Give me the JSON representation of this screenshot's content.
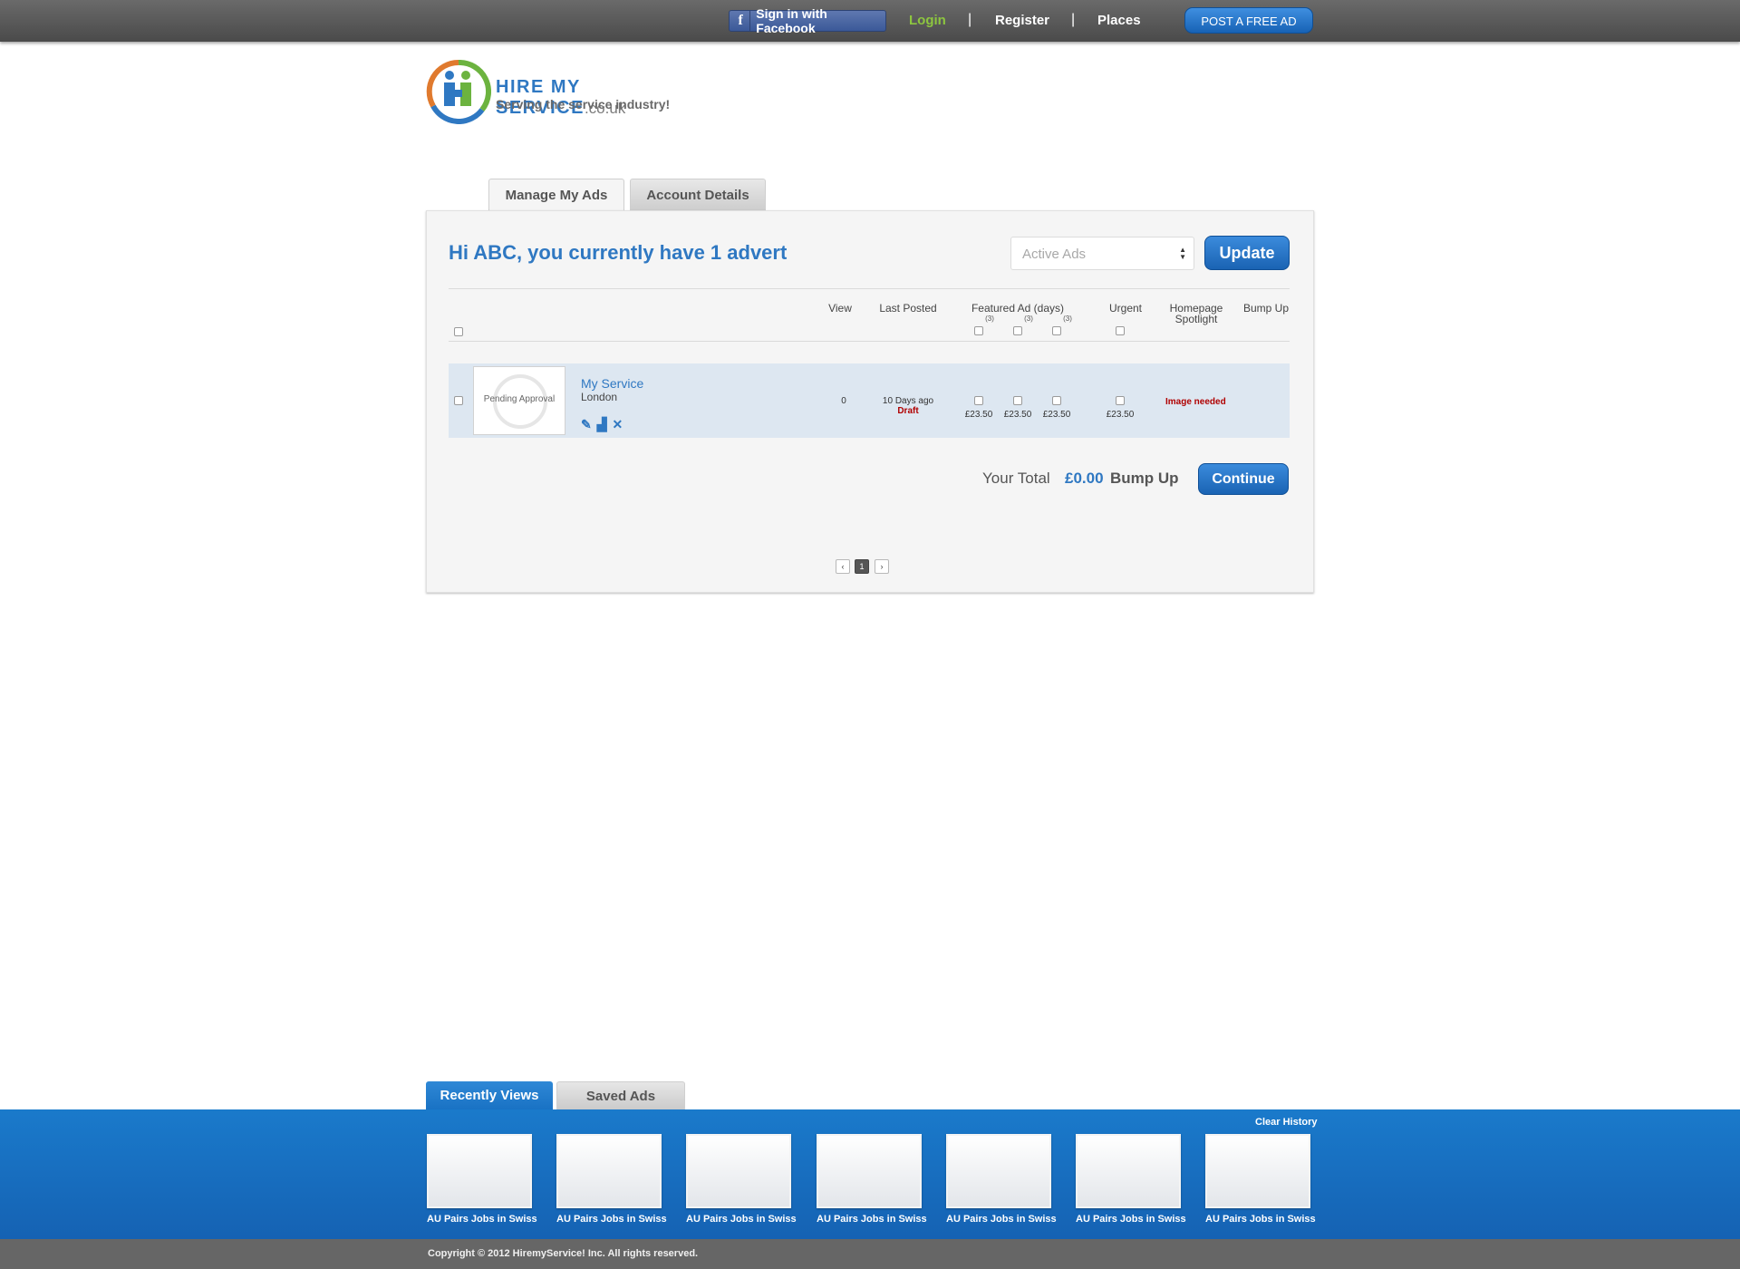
{
  "header": {
    "facebook_label": "Sign in with Facebook",
    "login": "Login",
    "register": "Register",
    "places": "Places",
    "separator": "|",
    "post_ad": "POST A FREE AD"
  },
  "logo": {
    "title": "HIRE MY SERVICE",
    "tld": ".co.uk",
    "tagline": "Serving the service industry!"
  },
  "tabs": [
    "Manage My Ads",
    "Account Details"
  ],
  "panel": {
    "greeting": "Hi ABC, you currently have 1 advert",
    "filter_value": "Active Ads",
    "update": "Update",
    "columns": {
      "view": "View",
      "last_posted": "Last Posted",
      "featured": "Featured Ad (days)",
      "featured_days": [
        "(3)",
        "(3)",
        "(3)"
      ],
      "urgent": "Urgent",
      "homepage": "Homepage Spotlight",
      "bump": "Bump Up"
    },
    "ad": {
      "thumb_text": "Pending Approval",
      "title": "My Service",
      "location": "London",
      "views": "0",
      "last_posted": "10 Days ago",
      "status": "Draft",
      "featured_prices": [
        "£23.50",
        "£23.50",
        "£23.50"
      ],
      "urgent_price": "£23.50",
      "homepage_note": "Image needed",
      "icons": [
        "edit-icon",
        "stats-icon",
        "delete-icon"
      ]
    },
    "total_label": "Your Total",
    "total_amount": "£0.00",
    "total_suffix": "Bump Up",
    "continue": "Continue",
    "pagination": {
      "prev": "‹",
      "current": "1",
      "next": "›"
    }
  },
  "bottom_tabs": [
    "Recently Views",
    "Saved Ads"
  ],
  "recent": {
    "clear": "Clear History",
    "items": [
      "AU Pairs Jobs in Swiss",
      "AU Pairs Jobs in Swiss",
      "AU Pairs Jobs in Swiss",
      "AU Pairs Jobs in Swiss",
      "AU Pairs Jobs in Swiss",
      "AU Pairs Jobs in Swiss",
      "AU Pairs Jobs in Swiss"
    ]
  },
  "footer": {
    "copyright": "Copyright © 2012 HiremyService! Inc. All rights reserved."
  },
  "colors": {
    "brand_blue": "#2f78c2",
    "login_green": "#8dc63f",
    "alert_red": "#b00000"
  }
}
